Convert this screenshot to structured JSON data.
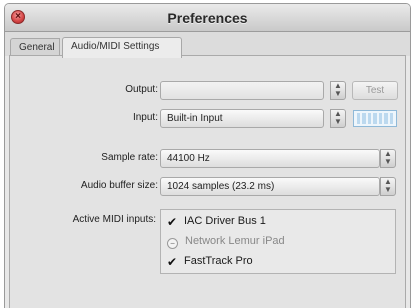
{
  "window": {
    "title": "Preferences"
  },
  "tabs": [
    {
      "label": "General"
    },
    {
      "label": "Audio/MIDI Settings"
    }
  ],
  "output": {
    "label": "Output:",
    "value": "",
    "test_label": "Test"
  },
  "input": {
    "label": "Input:",
    "value": "Built-in Input"
  },
  "sample_rate": {
    "label": "Sample rate:",
    "value": "44100 Hz"
  },
  "buffer": {
    "label": "Audio buffer size:",
    "value": "1024 samples (23.2 ms)"
  },
  "midi": {
    "label": "Active MIDI inputs:",
    "items": [
      {
        "name": "IAC Driver Bus 1",
        "checked": true
      },
      {
        "name": "Network Lemur iPad",
        "checked": false
      },
      {
        "name": "FastTrack Pro",
        "checked": true
      }
    ]
  },
  "icons": {
    "close": "close-icon",
    "check": "checkmark-icon",
    "stepper": "stepper-icon"
  },
  "colors": {
    "close": "#d84a4a",
    "meter": "#8fb9d8"
  }
}
